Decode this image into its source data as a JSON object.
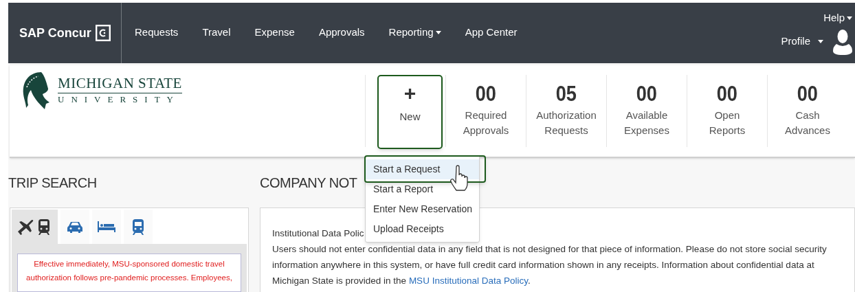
{
  "nav": {
    "brand": "SAP Concur",
    "items": [
      {
        "label": "Requests",
        "dropdown": false
      },
      {
        "label": "Travel",
        "dropdown": false
      },
      {
        "label": "Expense",
        "dropdown": false
      },
      {
        "label": "Approvals",
        "dropdown": false
      },
      {
        "label": "Reporting",
        "dropdown": true
      },
      {
        "label": "App Center",
        "dropdown": false
      }
    ],
    "help": "Help",
    "profile": "Profile"
  },
  "header": {
    "org_name": "MICHIGAN STATE",
    "org_subtitle": "UNIVERSITY",
    "new_tile": {
      "symbol": "+",
      "label": "New",
      "highlighted": true
    },
    "tiles": [
      {
        "count": "00",
        "label": [
          "Required",
          "Approvals"
        ]
      },
      {
        "count": "05",
        "label": [
          "Authorization",
          "Requests"
        ]
      },
      {
        "count": "00",
        "label": [
          "Available",
          "Expenses"
        ]
      },
      {
        "count": "00",
        "label": [
          "Open",
          "Reports"
        ]
      },
      {
        "count": "00",
        "label": [
          "Cash",
          "Advances"
        ]
      }
    ]
  },
  "new_menu": {
    "items": [
      {
        "label": "Start a Request",
        "selected": true
      },
      {
        "label": "Start a Report",
        "selected": false
      },
      {
        "label": "Enter New Reservation",
        "selected": false
      },
      {
        "label": "Upload Receipts",
        "selected": false
      }
    ]
  },
  "trip_search": {
    "title": "TRIP SEARCH",
    "tabs": [
      {
        "kind": "flight-rail",
        "selected": true
      },
      {
        "kind": "car",
        "selected": false
      },
      {
        "kind": "hotel",
        "selected": false
      },
      {
        "kind": "train",
        "selected": false
      }
    ],
    "notice_lines": [
      "Effective immediately, MSU-sponsored domestic travel",
      "authorization follows pre-pandemic processes. Employees,"
    ]
  },
  "company_notices": {
    "title": "COMPANY NOT",
    "heading": "Institutional Data Polic",
    "body": "Users should not enter confidential data in any field that is not designed for that piece of information. Please do not store social security information anywhere in this system, or have full credit card information shown in any receipts. Information about confidential data at Michigan State is provided in the ",
    "link": "MSU Institutional Data Policy",
    "after": "."
  }
}
